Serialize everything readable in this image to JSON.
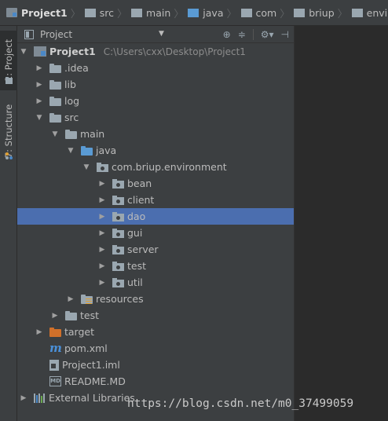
{
  "breadcrumb": {
    "items": [
      {
        "label": "Project1",
        "icon": "project-icon"
      },
      {
        "label": "src",
        "icon": "folder-icon"
      },
      {
        "label": "main",
        "icon": "folder-icon"
      },
      {
        "label": "java",
        "icon": "source-folder-icon"
      },
      {
        "label": "com",
        "icon": "folder-icon"
      },
      {
        "label": "briup",
        "icon": "folder-icon"
      },
      {
        "label": "environment",
        "icon": "folder-icon"
      }
    ]
  },
  "toolstrip": {
    "project_tab": "1: Project",
    "structure_tab": "7: Structure"
  },
  "panel": {
    "title": "Project",
    "dropdown_icon": "triangle-down-icon",
    "actions": [
      "locate-icon",
      "collapse-all-icon",
      "settings-icon",
      "hide-panel-icon"
    ]
  },
  "tree": {
    "rows": [
      {
        "label": "Project1",
        "path": "C:\\Users\\cxx\\Desktop\\Project1",
        "depth": 0,
        "arrow": "down",
        "icon": "project",
        "bold": true
      },
      {
        "label": ".idea",
        "depth": 1,
        "arrow": "right",
        "icon": "folder",
        "color": "#9aa7b0"
      },
      {
        "label": "lib",
        "depth": 1,
        "arrow": "right",
        "icon": "folder",
        "color": "#9aa7b0"
      },
      {
        "label": "log",
        "depth": 1,
        "arrow": "right",
        "icon": "folder",
        "color": "#9aa7b0"
      },
      {
        "label": "src",
        "depth": 1,
        "arrow": "down",
        "icon": "folder",
        "color": "#9aa7b0"
      },
      {
        "label": "main",
        "depth": 2,
        "arrow": "down",
        "icon": "folder",
        "color": "#9aa7b0"
      },
      {
        "label": "java",
        "depth": 3,
        "arrow": "down",
        "icon": "folder",
        "color": "#5a9bd4"
      },
      {
        "label": "com.briup.environment",
        "depth": 4,
        "arrow": "down",
        "icon": "package"
      },
      {
        "label": "bean",
        "depth": 5,
        "arrow": "right",
        "icon": "package"
      },
      {
        "label": "client",
        "depth": 5,
        "arrow": "right",
        "icon": "package"
      },
      {
        "label": "dao",
        "depth": 5,
        "arrow": "right",
        "icon": "package",
        "selected": true
      },
      {
        "label": "gui",
        "depth": 5,
        "arrow": "right",
        "icon": "package"
      },
      {
        "label": "server",
        "depth": 5,
        "arrow": "right",
        "icon": "package"
      },
      {
        "label": "test",
        "depth": 5,
        "arrow": "right",
        "icon": "package"
      },
      {
        "label": "util",
        "depth": 5,
        "arrow": "right",
        "icon": "package"
      },
      {
        "label": "resources",
        "depth": 3,
        "arrow": "right",
        "icon": "resources"
      },
      {
        "label": "test",
        "depth": 2,
        "arrow": "right",
        "icon": "folder",
        "color": "#9aa7b0"
      },
      {
        "label": "target",
        "depth": 1,
        "arrow": "right",
        "icon": "folder",
        "color": "#d0702a"
      },
      {
        "label": "pom.xml",
        "depth": 1,
        "arrow": "none",
        "icon": "maven"
      },
      {
        "label": "Project1.iml",
        "depth": 1,
        "arrow": "none",
        "icon": "iml"
      },
      {
        "label": "README.MD",
        "depth": 1,
        "arrow": "none",
        "icon": "md"
      },
      {
        "label": "External Libraries",
        "depth": 0,
        "arrow": "right",
        "icon": "libraries"
      }
    ]
  },
  "watermark": "https://blog.csdn.net/m0_37499059"
}
